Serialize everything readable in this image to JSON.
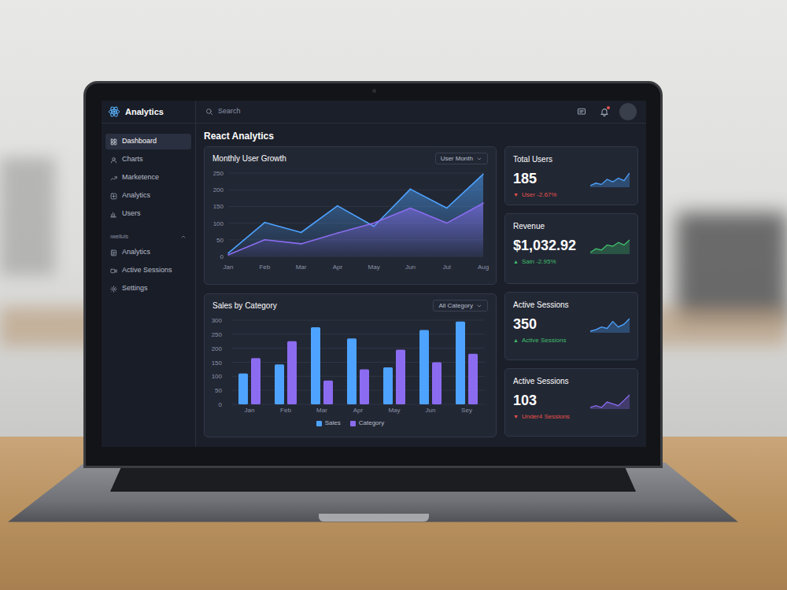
{
  "app": {
    "title": "Analytics"
  },
  "search": {
    "placeholder": "Search"
  },
  "notifications": {
    "unread": true
  },
  "sidebar": {
    "items": [
      {
        "label": "Dashboard",
        "selected": true
      },
      {
        "label": "Charts",
        "selected": false
      },
      {
        "label": "Marketence",
        "selected": false
      },
      {
        "label": "Analytics",
        "selected": false
      },
      {
        "label": "Users",
        "selected": false
      }
    ],
    "section": {
      "label": "ıwelluls",
      "expanded": true,
      "items": [
        {
          "label": "Analytics",
          "selected": false
        },
        {
          "label": "Active Sessions",
          "selected": false
        },
        {
          "label": "Settings",
          "selected": false
        }
      ]
    }
  },
  "page": {
    "title": "React Analytics"
  },
  "user_growth": {
    "title": "Monthly User Growth",
    "filter": "User Month",
    "y_ticks": [
      "250",
      "200",
      "150",
      "100",
      "50",
      "0"
    ],
    "x_labels": [
      "Jan",
      "Feb",
      "Mar",
      "Apr",
      "May",
      "Jun",
      "Jul",
      "Aug"
    ],
    "series": [
      {
        "values": [
          10,
          102,
          72,
          152,
          90,
          202,
          145,
          247
        ],
        "color": "#4da3ff"
      },
      {
        "values": [
          5,
          50,
          38,
          70,
          100,
          145,
          100,
          160
        ],
        "color": "#8b6cf0"
      }
    ]
  },
  "sales": {
    "title": "Sales by Category",
    "filter": "All Category",
    "y_ticks": [
      "300",
      "250",
      "200",
      "150",
      "100",
      "50",
      "0"
    ],
    "x_labels": [
      "Jan",
      "Feb",
      "Mar",
      "Apr",
      "May",
      "Jun",
      "Sey"
    ],
    "series": [
      {
        "name": "Sales",
        "values": [
          110,
          142,
          275,
          235,
          132,
          265,
          295
        ],
        "color": "#4da3ff"
      },
      {
        "name": "Category",
        "values": [
          165,
          225,
          85,
          125,
          195,
          150,
          180
        ],
        "color": "#8b6cf0"
      }
    ]
  },
  "stat_cards": [
    {
      "title": "Total Users",
      "value": "185",
      "arrow": "▼",
      "delta": "User -2.67%",
      "trend": "down",
      "spark_color": "#4da3ff",
      "spark": [
        4,
        6,
        5,
        9,
        7,
        10,
        8,
        14
      ]
    },
    {
      "title": "Revenue",
      "value": "$1,032.92",
      "arrow": "▲",
      "delta": "Sain -2.95%",
      "trend": "up",
      "spark_color": "#3fbf6a",
      "spark": [
        3,
        6,
        5,
        9,
        8,
        11,
        9,
        13
      ]
    },
    {
      "title": "Active Sessions",
      "value": "350",
      "arrow": "▲",
      "delta": "Active Sessions",
      "trend": "up",
      "spark_color": "#4da3ff",
      "spark": [
        4,
        5,
        7,
        6,
        11,
        7,
        9,
        13
      ]
    },
    {
      "title": "Active Sessions",
      "value": "103",
      "arrow": "▼",
      "delta": "Under4 Sessions",
      "trend": "down",
      "spark_color": "#8b6cf0",
      "spark": [
        5,
        6,
        5,
        8,
        7,
        6,
        9,
        12
      ]
    }
  ]
}
